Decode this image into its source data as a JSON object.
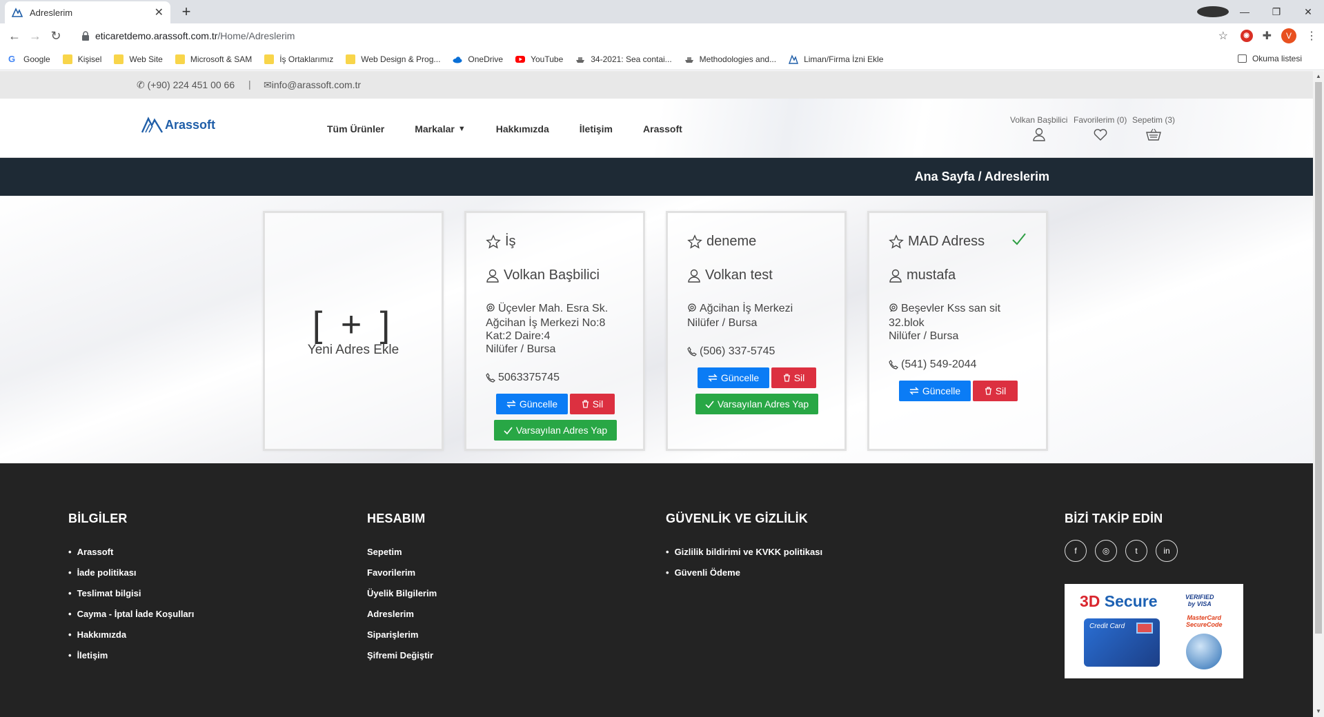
{
  "browser": {
    "tab_title": "Adreslerim",
    "url_domain": "eticaretdemo.arassoft.com.tr",
    "url_path": "/Home/Adreslerim",
    "profile_initial": "V",
    "bookmarks": [
      {
        "label": "Google",
        "icon": "google-icon"
      },
      {
        "label": "Kişisel",
        "icon": "folder-icon"
      },
      {
        "label": "Web Site",
        "icon": "folder-icon"
      },
      {
        "label": "Microsoft & SAM",
        "icon": "folder-icon"
      },
      {
        "label": "İş Ortaklarımız",
        "icon": "folder-icon"
      },
      {
        "label": "Web Design & Prog...",
        "icon": "folder-icon"
      },
      {
        "label": "OneDrive",
        "icon": "cloud-icon"
      },
      {
        "label": "YouTube",
        "icon": "youtube-icon"
      },
      {
        "label": "34-2021: Sea contai...",
        "icon": "ship-icon"
      },
      {
        "label": "Methodologies and...",
        "icon": "ship-icon"
      },
      {
        "label": "Liman/Firma İzni Ekle",
        "icon": "arassoft-icon"
      }
    ],
    "reading_list": "Okuma listesi"
  },
  "topbar": {
    "phone": "(+90) 224 451 00 66",
    "separator": "|",
    "email": "info@arassoft.com.tr"
  },
  "header": {
    "brand": "Arassoft",
    "nav": [
      "Tüm Ürünler",
      "Markalar",
      "Hakkımızda",
      "İletişim",
      "Arassoft"
    ],
    "user_label": "Volkan Başbilici",
    "favorites_label": "Favorilerim (0)",
    "cart_label": "Sepetim (3)"
  },
  "breadcrumb": "Ana Sayfa / Adreslerim",
  "add_card": {
    "plus": "[ + ]",
    "label": "Yeni Adres Ekle"
  },
  "addresses": [
    {
      "title": "İş",
      "name": "Volkan Başbilici",
      "lines": [
        "Üçevler Mah. Esra Sk.",
        "Ağcihan İş Merkezi No:8",
        "Kat:2 Daire:4",
        "Nilüfer / Bursa"
      ],
      "phone": "5063375745",
      "update_label": "Güncelle",
      "delete_label": "Sil",
      "default_label": "Varsayılan Adres Yap",
      "is_default": false
    },
    {
      "title": "deneme",
      "name": "Volkan test",
      "lines": [
        "Ağcihan İş Merkezi",
        "Nilüfer / Bursa"
      ],
      "phone": "(506) 337-5745",
      "update_label": "Güncelle",
      "delete_label": "Sil",
      "default_label": "Varsayılan Adres Yap",
      "is_default": false
    },
    {
      "title": "MAD Adress",
      "name": "mustafa",
      "lines": [
        "Beşevler Kss san sit",
        "32.blok",
        "Nilüfer / Bursa"
      ],
      "phone": "(541) 549-2044",
      "update_label": "Güncelle",
      "delete_label": "Sil",
      "is_default": true
    }
  ],
  "footer": {
    "bilgiler": {
      "title": "BİLGİLER",
      "items": [
        "Arassoft",
        "İade politikası",
        "Teslimat bilgisi",
        "Cayma - İptal İade Koşulları",
        "Hakkımızda",
        "İletişim"
      ]
    },
    "hesabim": {
      "title": "HESABIM",
      "items": [
        "Sepetim",
        "Favorilerim",
        "Üyelik Bilgilerim",
        "Adreslerim",
        "Siparişlerim",
        "Şifremi Değiştir"
      ]
    },
    "guvenlik": {
      "title": "GÜVENLİK VE GİZLİLİK",
      "items": [
        "Gizlilik bildirimi ve KVKK politikası",
        "Güvenli Ödeme"
      ]
    },
    "takip": {
      "title": "BİZİ TAKİP EDİN",
      "social": [
        "f",
        "◎",
        "t",
        "in"
      ]
    },
    "secure": {
      "three_d": "3D",
      "secure": "Secure",
      "verified": "VERIFIED",
      "by_visa": "by VISA",
      "mastercard": "MasterCard",
      "securecode": "SecureCode",
      "credit_card": "Credit Card"
    }
  },
  "colors": {
    "brand_blue": "#1f5ea8",
    "breadcrumb_bg": "#1e2a35",
    "footer_bg": "#232323",
    "btn_update": "#0b7cf5",
    "btn_delete": "#dc3040",
    "btn_default": "#28a745"
  }
}
